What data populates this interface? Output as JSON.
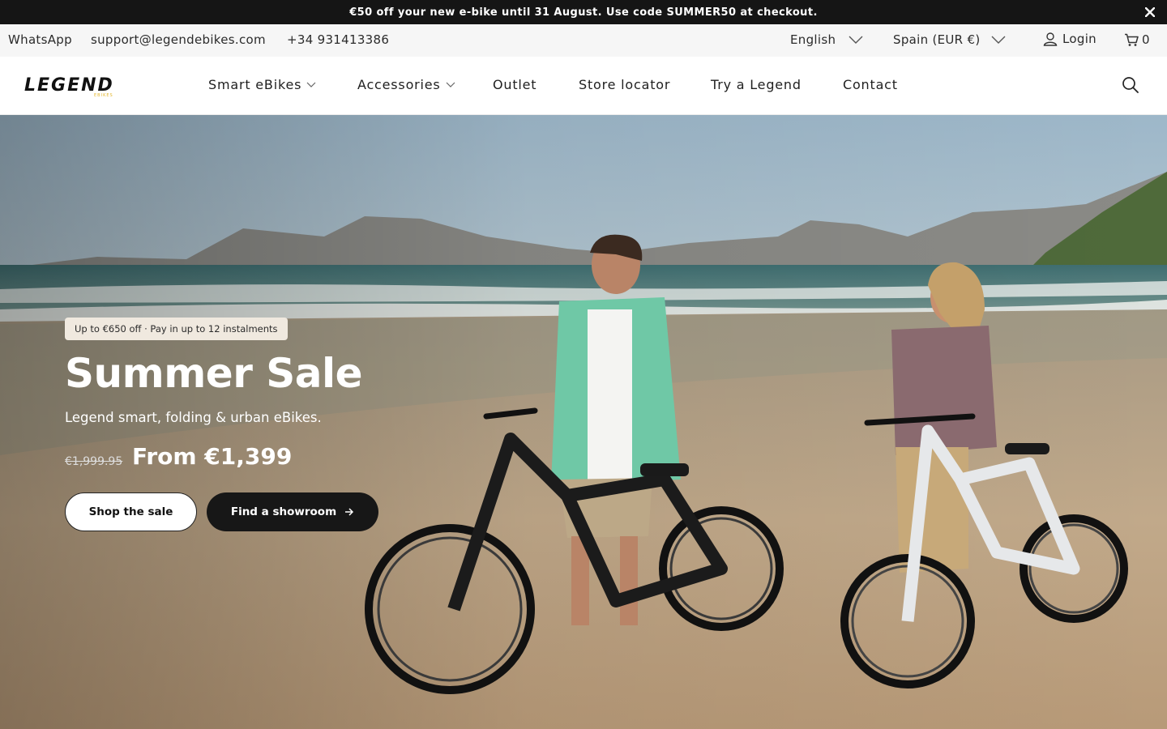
{
  "announcement": {
    "text_before": "€50 off your new e-bike until 31 August. Use code ",
    "code": "SUMMER50",
    "text_after": " at checkout."
  },
  "utility": {
    "whatsapp": "WhatsApp",
    "email": "support@legendebikes.com",
    "phone": "+34 931413386",
    "language": "English",
    "region": "Spain (EUR €)",
    "login": "Login",
    "cart_count": "0"
  },
  "nav": {
    "items": [
      {
        "label": "Smart eBikes",
        "has_dropdown": true
      },
      {
        "label": "Accessories",
        "has_dropdown": true
      },
      {
        "label": "Outlet",
        "has_dropdown": false
      },
      {
        "label": "Store locator",
        "has_dropdown": false
      },
      {
        "label": "Try a Legend",
        "has_dropdown": false
      },
      {
        "label": "Contact",
        "has_dropdown": false
      }
    ]
  },
  "brand": {
    "logo_text": "LEGEND",
    "logo_subtext": "EBIKES",
    "accent": "#e3b52a"
  },
  "hero": {
    "badge": "Up to €650 off · Pay in up to 12 instalments",
    "title": "Summer Sale",
    "subtitle": "Legend smart, folding & urban eBikes.",
    "price_old": "€1,999.95",
    "price_new": "From €1,399",
    "cta_primary": "Shop the sale",
    "cta_secondary": "Find a showroom",
    "image_description_icon": "beach-ebike-photo"
  },
  "colors": {
    "announcement_bg": "#151515",
    "utility_bg": "#f6f6f6",
    "badge_bg": "#f0e9df",
    "dark_button": "#171717"
  }
}
